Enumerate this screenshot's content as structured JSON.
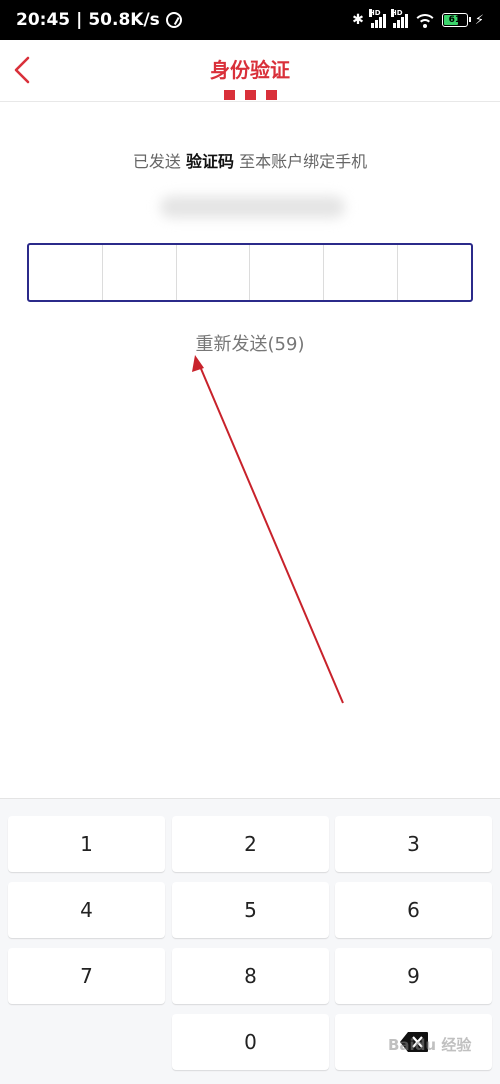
{
  "status_bar": {
    "time": "20:45",
    "separator": "|",
    "speed": "50.8K/s",
    "signal1_label": "HD",
    "signal2_label": "HD",
    "battery": "61",
    "battery_fill_fraction": 0.61
  },
  "header": {
    "title": "身份验证",
    "back_icon": "chevron-left-icon",
    "accent_color": "#d9303a"
  },
  "verify": {
    "hint_prefix": "已发送",
    "hint_bold": "验证码",
    "hint_suffix": "至本账户绑定手机",
    "code_cells": [
      "",
      "",
      "",
      "",
      "",
      ""
    ],
    "resend": "重新发送(59)",
    "box_border_color": "#2b2a8a"
  },
  "keypad": {
    "keys": [
      "1",
      "2",
      "3",
      "4",
      "5",
      "6",
      "7",
      "8",
      "9",
      "",
      "0",
      ""
    ],
    "delete_icon": "backspace-icon"
  },
  "annotation": {
    "arrow_color": "#c8222b"
  }
}
